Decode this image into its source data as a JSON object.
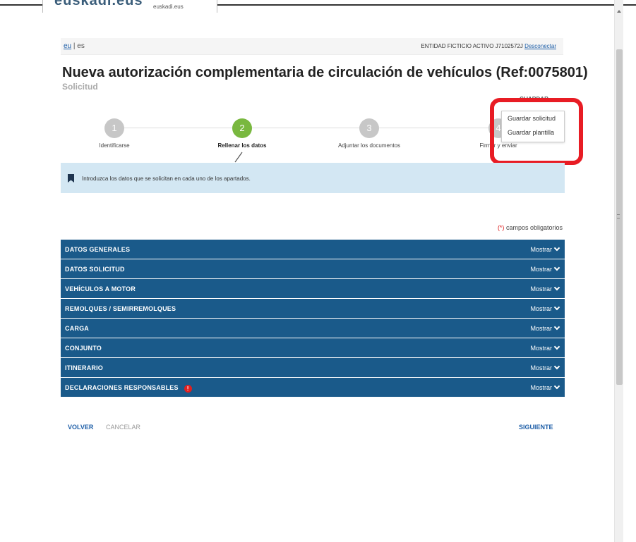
{
  "header": {
    "logo_text": "euskadi.eus",
    "logo_sub": "euskadi.eus"
  },
  "lang": {
    "eu": "eu",
    "separator": "|",
    "es": "es",
    "entity": "ENTIDAD FICTICIO ACTIVO J7102572J",
    "disconnect": "Desconectar"
  },
  "page": {
    "title": "Nueva autorización complementaria de circulación de vehículos (Ref:0075801)",
    "subtitle": "Solicitud"
  },
  "steps": [
    {
      "number": "1",
      "label": "Identificarse"
    },
    {
      "number": "2",
      "label": "Rellenar los datos"
    },
    {
      "number": "3",
      "label": "Adjuntar los documentos"
    },
    {
      "number": "4",
      "label": "Firmar y enviar"
    }
  ],
  "active_step": 2,
  "menu": {
    "header": "GUARDAR",
    "items": [
      "Guardar solicitud",
      "Guardar plantilla"
    ]
  },
  "banner": {
    "text": "Introduzca los datos que se solicitan en cada uno de los apartados."
  },
  "required_note": {
    "star": "(*)",
    "text": "campos obligatorios"
  },
  "sections": [
    {
      "title": "DATOS GENERALES",
      "toggle": "Mostrar"
    },
    {
      "title": "DATOS SOLICITUD",
      "toggle": "Mostrar"
    },
    {
      "title": "VEHÍCULOS A MOTOR",
      "toggle": "Mostrar"
    },
    {
      "title": "REMOLQUES / SEMIRREMOLQUES",
      "toggle": "Mostrar"
    },
    {
      "title": "CARGA",
      "toggle": "Mostrar"
    },
    {
      "title": "CONJUNTO",
      "toggle": "Mostrar"
    },
    {
      "title": "ITINERARIO",
      "toggle": "Mostrar"
    },
    {
      "title": "DECLARACIONES RESPONSABLES",
      "toggle": "Mostrar",
      "warning": "!"
    }
  ],
  "footer": {
    "back": "VOLVER",
    "cancel": "CANCELAR",
    "next": "SIGUIENTE"
  },
  "colors": {
    "accordion": "#1a5a8a",
    "active_step": "#79b83f",
    "inactive_step": "#c7c7c7",
    "highlight": "#e81c24",
    "banner": "#d3e7f3",
    "link": "#1f5fa8"
  }
}
